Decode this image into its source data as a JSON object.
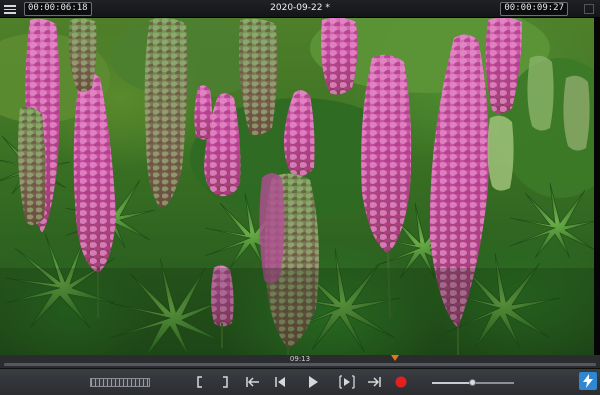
{
  "topbar": {
    "current_time": "00:00:06:18",
    "title": "2020-09-22 *",
    "total_time": "00:00:09:27"
  },
  "timeline": {
    "position_label": "09:13",
    "playhead_fraction": 0.66,
    "playhead_color": "#e07a12"
  },
  "controls": {
    "buttons": [
      {
        "name": "jog-shuttle",
        "icon": "jog-shuttle-icon"
      },
      {
        "name": "mark-in",
        "icon": "mark-in-bracket-icon",
        "glyph": "["
      },
      {
        "name": "mark-out",
        "icon": "mark-out-bracket-icon",
        "glyph": "]"
      },
      {
        "name": "go-to-in",
        "icon": "go-to-in-icon"
      },
      {
        "name": "step-back",
        "icon": "step-back-icon"
      },
      {
        "name": "play",
        "icon": "play-icon"
      },
      {
        "name": "step-forward",
        "icon": "step-forward-icon"
      },
      {
        "name": "go-to-out",
        "icon": "go-to-out-icon"
      },
      {
        "name": "record",
        "icon": "record-icon",
        "color": "#e32020"
      }
    ],
    "volume_fraction": 0.5,
    "accent": "#2f86d1"
  }
}
